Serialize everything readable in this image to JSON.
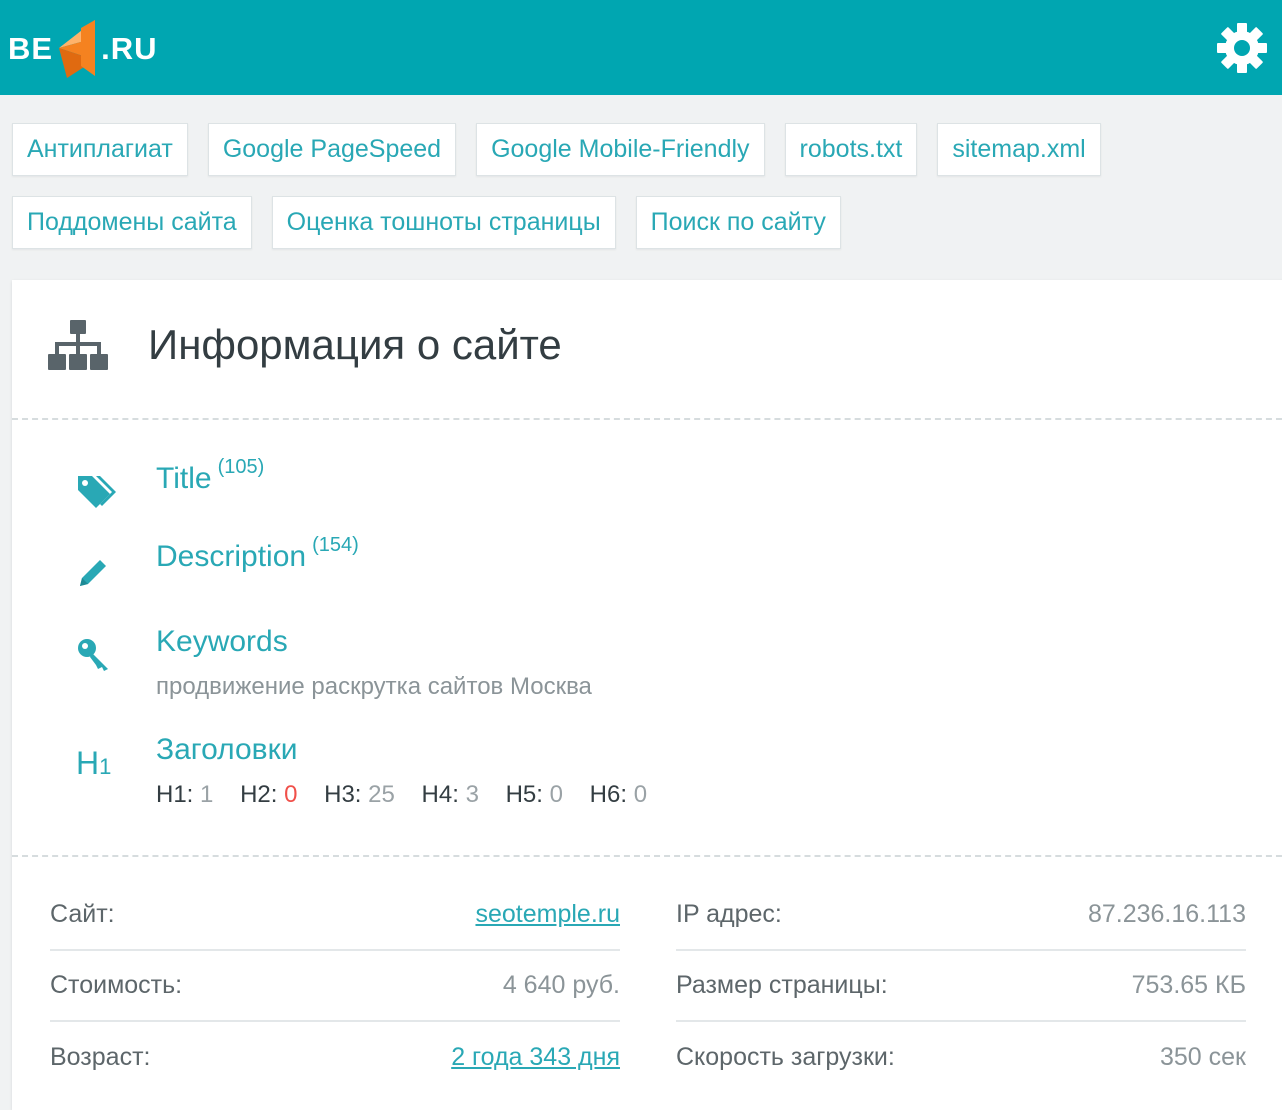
{
  "header": {
    "logo_left": "BE",
    "logo_right": ".RU"
  },
  "tools": {
    "row1": [
      "Антиплагиат",
      "Google PageSpeed",
      "Google Mobile-Friendly",
      "robots.txt",
      "sitemap.xml"
    ],
    "row2": [
      "Поддомены сайта",
      "Оценка тошноты страницы",
      "Поиск по сайту"
    ]
  },
  "card": {
    "title": "Информация о сайте"
  },
  "meta": {
    "title": {
      "label": "Title",
      "count": "(105)"
    },
    "description": {
      "label": "Description",
      "count": "(154)"
    },
    "keywords": {
      "label": "Keywords",
      "value": "продвижение раскрутка сайтов Москва"
    },
    "headings": {
      "label": "Заголовки",
      "icon_text": "H",
      "icon_sub": "1",
      "counts": [
        {
          "name": "H1:",
          "value": "1"
        },
        {
          "name": "H2:",
          "value": "0"
        },
        {
          "name": "H3:",
          "value": "25"
        },
        {
          "name": "H4:",
          "value": "3"
        },
        {
          "name": "H5:",
          "value": "0"
        },
        {
          "name": "H6:",
          "value": "0"
        }
      ]
    }
  },
  "info": {
    "left": [
      {
        "key": "Сайт:",
        "value": "seotemple.ru"
      },
      {
        "key": "Стоимость:",
        "value": "4 640 руб."
      },
      {
        "key": "Возраст:",
        "value": "2 года 343 дня"
      }
    ],
    "right": [
      {
        "key": "IP адрес:",
        "value": "87.236.16.113"
      },
      {
        "key": "Размер страницы:",
        "value": "753.65 КБ"
      },
      {
        "key": "Скорость загрузки:",
        "value": "350 сек"
      }
    ]
  },
  "colors": {
    "header_bg": "#00a6b1",
    "accent": "#29a8b5",
    "logo_orange": "#f58220",
    "alert_red": "#f0504a"
  },
  "icons": [
    "gear-icon",
    "sitemap-icon",
    "tags-icon",
    "pencil-icon",
    "key-icon",
    "h1-icon"
  ]
}
